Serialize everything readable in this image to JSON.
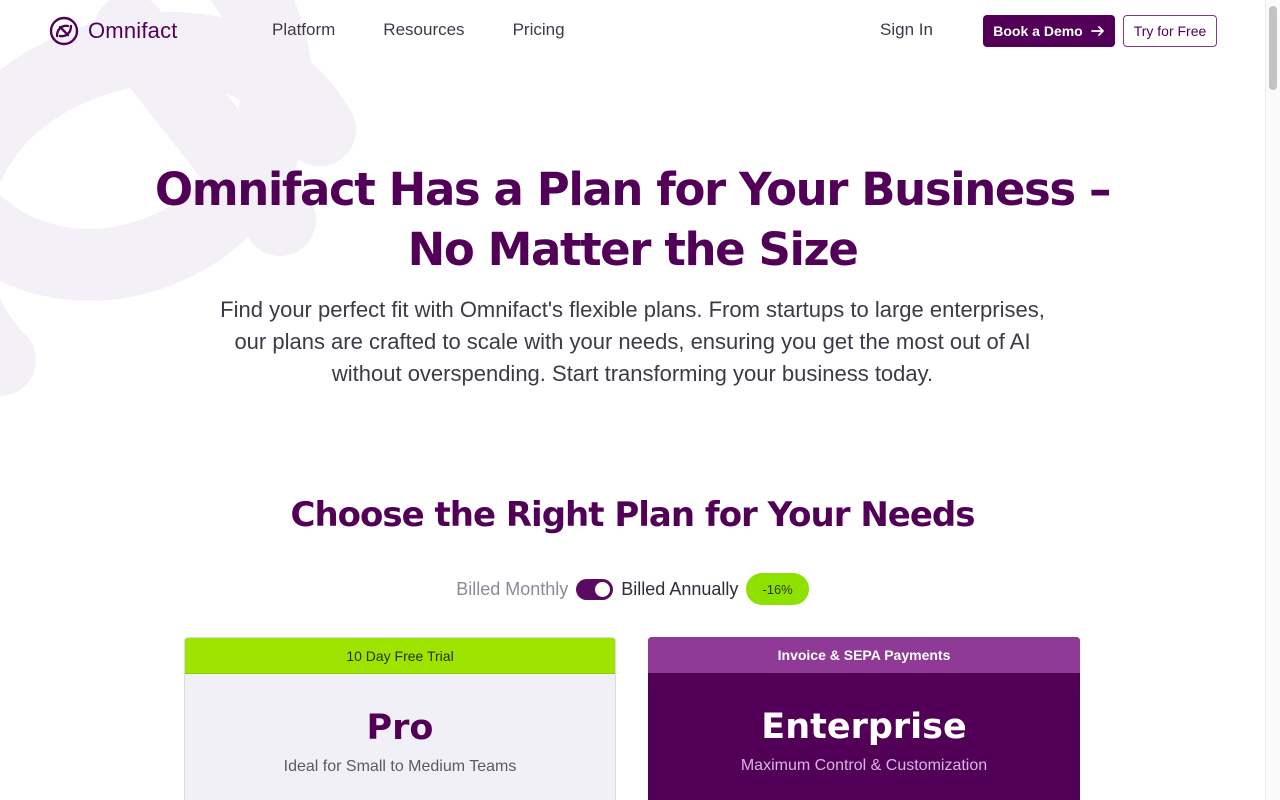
{
  "header": {
    "logo_text": "Omnifact",
    "nav": [
      "Platform",
      "Resources",
      "Pricing"
    ],
    "sign_in": "Sign In",
    "book_demo": "Book a Demo",
    "try_free": "Try for Free"
  },
  "hero": {
    "title_line1": "Omnifact Has a Plan for Your Business –",
    "title_line2": "No Matter the Size",
    "subtitle_line1": "Find your perfect fit with Omnifact's flexible plans. From startups to large enterprises,",
    "subtitle_line2": "our plans are crafted to scale with your needs, ensuring you get the most out of AI",
    "subtitle_line3": "without overspending. Start transforming your business today."
  },
  "plans_section": {
    "title": "Choose the Right Plan for Your Needs",
    "billing": {
      "monthly_label": "Billed Monthly",
      "annual_label": "Billed Annually",
      "annual_selected": true,
      "discount": "-16%"
    },
    "cards": [
      {
        "banner": "10 Day Free Trial",
        "name": "Pro",
        "description": "Ideal for Small to Medium Teams"
      },
      {
        "banner": "Invoice & SEPA Payments",
        "name": "Enterprise",
        "description": "Maximum Control & Customization"
      }
    ]
  },
  "colors": {
    "brand": "#520057",
    "accent_green": "#9ee400",
    "enterprise_banner": "#8e3a96"
  }
}
